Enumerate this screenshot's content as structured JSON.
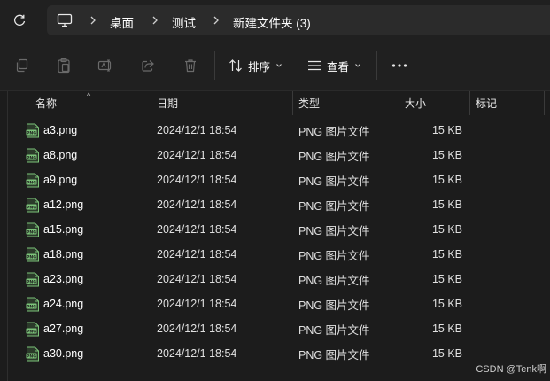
{
  "breadcrumb": {
    "items": [
      "桌面",
      "测试",
      "新建文件夹 (3)"
    ]
  },
  "toolbar": {
    "sort_label": "排序",
    "view_label": "查看"
  },
  "columns": {
    "name": "名称",
    "date": "日期",
    "type": "类型",
    "size": "大小",
    "tags": "标记"
  },
  "files": [
    {
      "name": "a3.png",
      "date": "2024/12/1 18:54",
      "type": "PNG 图片文件",
      "size": "15 KB"
    },
    {
      "name": "a8.png",
      "date": "2024/12/1 18:54",
      "type": "PNG 图片文件",
      "size": "15 KB"
    },
    {
      "name": "a9.png",
      "date": "2024/12/1 18:54",
      "type": "PNG 图片文件",
      "size": "15 KB"
    },
    {
      "name": "a12.png",
      "date": "2024/12/1 18:54",
      "type": "PNG 图片文件",
      "size": "15 KB"
    },
    {
      "name": "a15.png",
      "date": "2024/12/1 18:54",
      "type": "PNG 图片文件",
      "size": "15 KB"
    },
    {
      "name": "a18.png",
      "date": "2024/12/1 18:54",
      "type": "PNG 图片文件",
      "size": "15 KB"
    },
    {
      "name": "a23.png",
      "date": "2024/12/1 18:54",
      "type": "PNG 图片文件",
      "size": "15 KB"
    },
    {
      "name": "a24.png",
      "date": "2024/12/1 18:54",
      "type": "PNG 图片文件",
      "size": "15 KB"
    },
    {
      "name": "a27.png",
      "date": "2024/12/1 18:54",
      "type": "PNG 图片文件",
      "size": "15 KB"
    },
    {
      "name": "a30.png",
      "date": "2024/12/1 18:54",
      "type": "PNG 图片文件",
      "size": "15 KB"
    }
  ],
  "icons": {
    "refresh": "refresh-icon",
    "computer": "computer-icon",
    "copy": "copy-icon",
    "paste": "paste-icon",
    "rename": "rename-icon",
    "share": "share-icon",
    "delete": "trash-icon",
    "sort": "sort-icon",
    "view": "view-icon",
    "more": "more-icon",
    "file": "png-file-icon"
  },
  "watermark": "CSDN @Tenk啊",
  "colors": {
    "background": "#1c1c1c",
    "bar": "#202020",
    "breadcrumb_bg": "#2b2b2b",
    "file_icon": "#7cc47a"
  }
}
